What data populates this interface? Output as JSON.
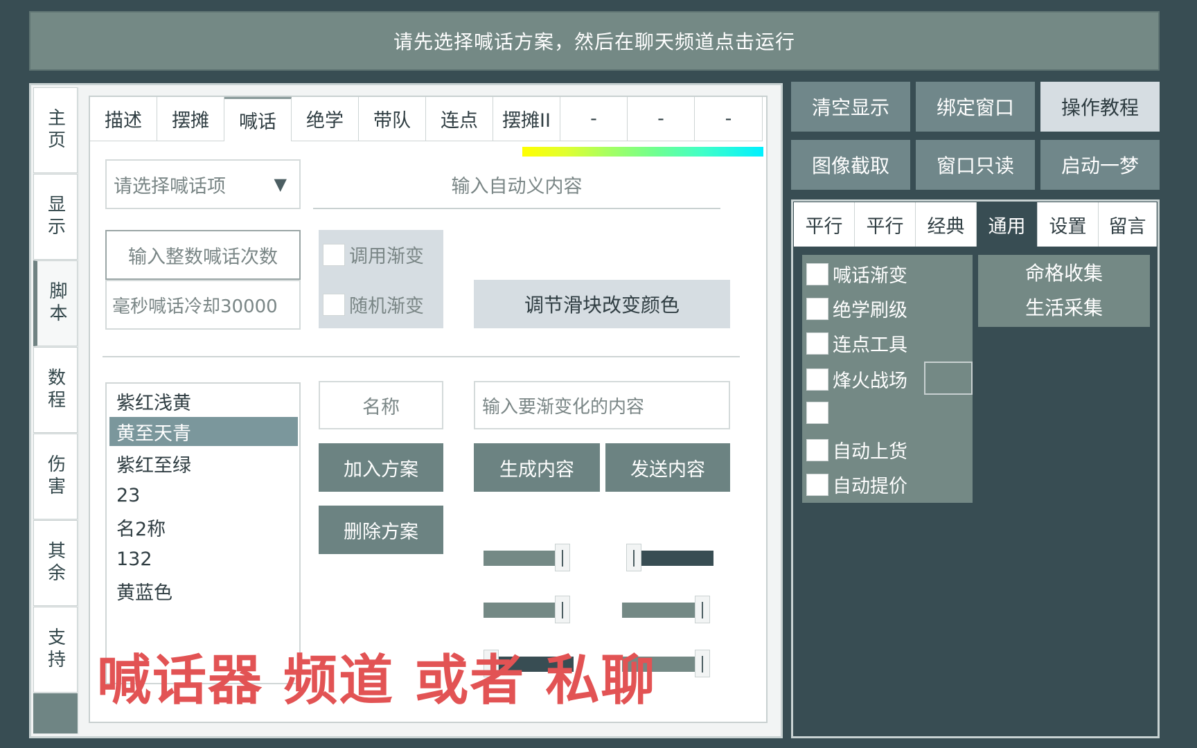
{
  "banner": {
    "text": "请先选择喊话方案，然后在聊天频道点击运行"
  },
  "side_tabs": [
    "主页",
    "显示",
    "脚本",
    "数程",
    "伤害",
    "其余",
    "支持"
  ],
  "top_tabs": [
    "描述",
    "摆摊",
    "喊话",
    "绝学",
    "带队",
    "连点",
    "摆摊II",
    "-",
    "-",
    "-"
  ],
  "active_top_tab": "喊话",
  "shout": {
    "select_placeholder": "请选择喊话项",
    "dropdown_arrow": "▼",
    "custom_input_placeholder": "输入自动义内容",
    "count_input_placeholder": "输入整数喊话次数",
    "cooldown_placeholder": "毫秒喊话冷却30000",
    "checkbox_gradient": "调用渐变",
    "checkbox_random": "随机渐变",
    "color_slider_button": "调节滑块改变颜色",
    "name_label": "名称",
    "gradient_input_placeholder": "输入要渐变化的内容",
    "add_plan": "加入方案",
    "delete_plan": "删除方案",
    "generate_content": "生成内容",
    "send_content": "发送内容"
  },
  "plans": [
    "紫红浅黄",
    "黄至天青",
    "紫红至绿",
    "23",
    "名2称",
    "132",
    "黄蓝色"
  ],
  "selected_plan": "黄至天青",
  "sliders": [
    {
      "name": "slider-1",
      "value": 0.95
    },
    {
      "name": "slider-2",
      "value": 0.05
    },
    {
      "name": "slider-3",
      "value": 0.95
    },
    {
      "name": "slider-4",
      "value": 0.95
    },
    {
      "name": "slider-5",
      "value": 0.0
    },
    {
      "name": "slider-6",
      "value": 0.95
    }
  ],
  "overlay_caption": "喊话器  频道 或者 私聊",
  "right_buttons": [
    "清空显示",
    "绑定窗口",
    "操作教程",
    "图像截取",
    "窗口只读",
    "启动一梦"
  ],
  "right_tabs": [
    "平行",
    "平行",
    "经典",
    "通用",
    "设置",
    "留言"
  ],
  "active_right_tab": "通用",
  "options": [
    "喊话渐变",
    "绝学刷级",
    "连点工具",
    "烽火战场",
    "",
    "自动上货",
    "自动提价"
  ],
  "collect": [
    "命格收集",
    "生活采集"
  ],
  "colors": {
    "background": "#384d53",
    "panel": "#748985",
    "selected": "#7b979c",
    "overlay_text": "#e25354"
  }
}
